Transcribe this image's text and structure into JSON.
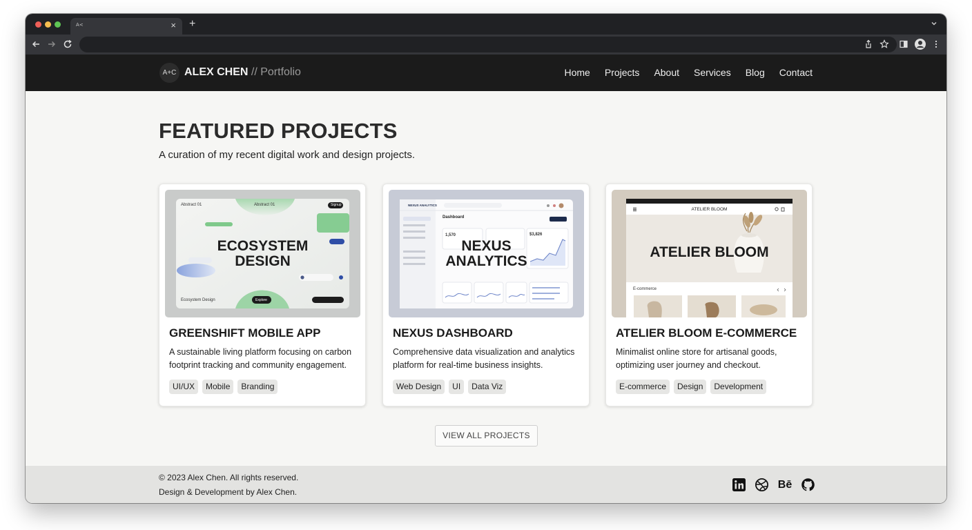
{
  "browser": {
    "tab_favicon": "A<",
    "close_icon": "close-icon",
    "new_tab_icon": "plus-icon"
  },
  "header": {
    "logo_badge": "A+C",
    "brand_name": "ALEX CHEN",
    "brand_suffix": " // Portfolio",
    "nav": [
      "Home",
      "Projects",
      "About",
      "Services",
      "Blog",
      "Contact"
    ]
  },
  "main": {
    "title": "FEATURED PROJECTS",
    "subtitle": "A curation of my recent digital work and design projects.",
    "cards": [
      {
        "image_title_line1": "ECOSYSTEM",
        "image_title_line2": "DESIGN",
        "image_label_tl": "Abstract 01",
        "image_label_tc": "Abstract 01",
        "image_btn": "Signup",
        "image_label_bl": "Ecosystem Design",
        "image_btn_bottom": "Explore",
        "title": "GREENSHIFT MOBILE APP",
        "description": "A sustainable living platform focusing on carbon footprint tracking and community engagement.",
        "tags": [
          "UI/UX",
          "Mobile",
          "Branding"
        ]
      },
      {
        "image_title_line1": "NEXUS",
        "image_title_line2": "ANALYTICS",
        "image_brand": "NEXUS ANALYTICS",
        "image_heading": "Dashboard",
        "image_stat1": "1,570",
        "image_stat2": "$3,826",
        "title": "NEXUS DASHBOARD",
        "description": "Comprehensive data visualization and analytics platform for real-time business insights.",
        "tags": [
          "Web Design",
          "UI",
          "Data Viz"
        ]
      },
      {
        "image_title": "ATELIER BLOOM",
        "image_nav_brand": "ATELIER BLOOM",
        "image_section": "E-commerce",
        "title": "ATELIER BLOOM E-COMMERCE",
        "description": "Minimalist online store for artisanal goods, optimizing user journey and checkout.",
        "tags": [
          "E-commerce",
          "Design",
          "Development"
        ]
      }
    ],
    "view_all_label": "VIEW ALL PROJECTS"
  },
  "footer": {
    "copyright": "© 2023 Alex Chen. All rights reserved.",
    "credit": "Design & Development by Alex Chen.",
    "social_behance": "Bē",
    "socials": [
      "linkedin-icon",
      "dribbble-icon",
      "behance-icon",
      "github-icon"
    ]
  }
}
